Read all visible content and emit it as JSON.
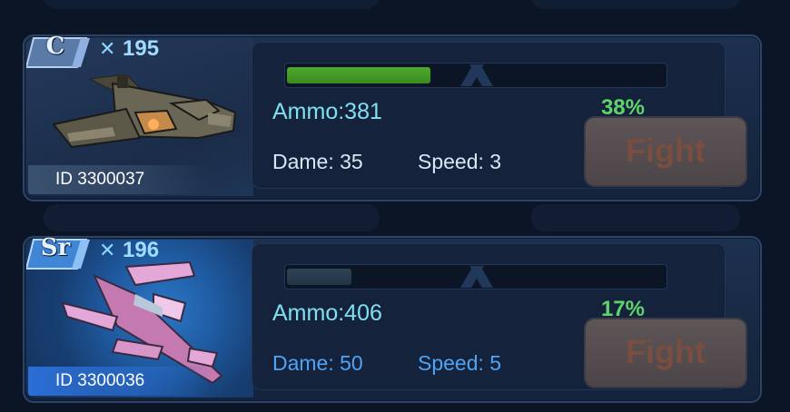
{
  "cards": [
    {
      "rank": "C",
      "power": "195",
      "ship_icon": "gunship-dark-icon",
      "id_label": "ID 3300037",
      "progress_percent": 38,
      "percent_label": "38%",
      "ammo": "Ammo:381",
      "dame": "Dame: 35",
      "speed": "Speed: 3",
      "fight_label": "Fight"
    },
    {
      "rank": "Sr",
      "power": "196",
      "ship_icon": "jet-pink-icon",
      "id_label": "ID 3300036",
      "progress_percent": 17,
      "percent_label": "17%",
      "ammo": "Ammo:406",
      "dame": "Dame: 50",
      "speed": "Speed: 5",
      "fight_label": "Fight"
    }
  ],
  "colors": {
    "progress_full": "#3a8a1f",
    "percent_text": "#5fd46a",
    "fight_disabled_bg": "#5e5557",
    "fight_disabled_text": "#7a4e3f"
  }
}
